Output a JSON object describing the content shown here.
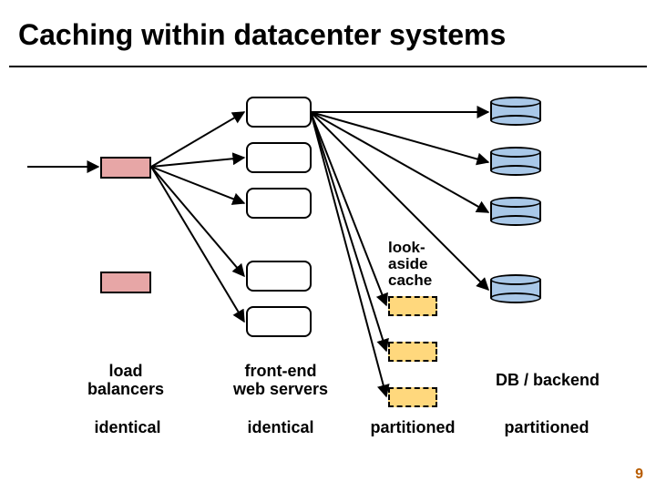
{
  "title": "Caching within datacenter systems",
  "labels": {
    "lookaside": "look-\naside\ncache",
    "load_balancers": "load\nbalancers",
    "front_end": "front-end\nweb servers",
    "db_backend": "DB / backend",
    "identical1": "identical",
    "identical2": "identical",
    "partitioned1": "partitioned",
    "partitioned2": "partitioned"
  },
  "page_number": "9"
}
